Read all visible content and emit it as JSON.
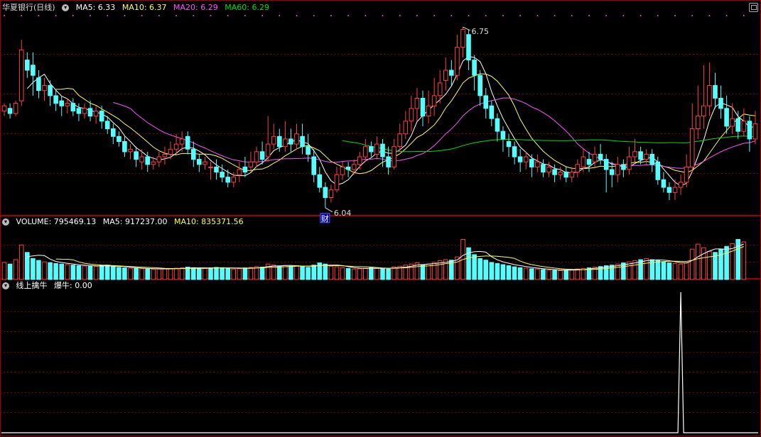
{
  "colors": {
    "up": "#ff4040",
    "down": "#54ffff",
    "ma5": "#ffffff",
    "ma10": "#ffff54",
    "ma20": "#ff54ff",
    "ma60": "#00e000",
    "grid": "#7a0000",
    "border": "#a00000",
    "signal": "#ffffff",
    "marker": "#ff40ff"
  },
  "header": {
    "stock_name": "华夏银行(日线)",
    "ma5": "MA5: 6.33",
    "ma10": "MA10: 6.37",
    "ma20": "MA20: 6.29",
    "ma60": "MA60: 6.29"
  },
  "volume_header": {
    "volume": "VOLUME: 795469.13",
    "ma5": "MA5: 917237.00",
    "ma10": "MA10: 835371.56"
  },
  "indicator_header": {
    "name": "线上擒牛",
    "value": "爆牛: 0.00"
  },
  "annotations": {
    "high_label": "6.75",
    "low_label": "6.04",
    "finance_tag": "财"
  },
  "chart_data": [
    {
      "type": "candlestick",
      "title": "华夏银行(日线)",
      "series_names": [
        "MA5",
        "MA10",
        "MA20",
        "MA60"
      ],
      "ylim": [
        6.02,
        6.8
      ],
      "candles": [
        [
          6.42,
          6.44,
          6.4,
          6.45
        ],
        [
          6.43,
          6.41,
          6.39,
          6.45
        ],
        [
          6.41,
          6.45,
          6.4,
          6.46
        ],
        [
          6.46,
          6.66,
          6.44,
          6.7
        ],
        [
          6.62,
          6.58,
          6.55,
          6.65
        ],
        [
          6.6,
          6.56,
          6.48,
          6.65
        ],
        [
          6.55,
          6.5,
          6.47,
          6.58
        ],
        [
          6.5,
          6.52,
          6.46,
          6.55
        ],
        [
          6.52,
          6.48,
          6.44,
          6.54
        ],
        [
          6.48,
          6.45,
          6.42,
          6.5
        ],
        [
          6.46,
          6.44,
          6.4,
          6.48
        ],
        [
          6.44,
          6.45,
          6.41,
          6.47
        ],
        [
          6.45,
          6.42,
          6.4,
          6.47
        ],
        [
          6.43,
          6.41,
          6.38,
          6.45
        ],
        [
          6.41,
          6.43,
          6.39,
          6.45
        ],
        [
          6.43,
          6.4,
          6.38,
          6.46
        ],
        [
          6.4,
          6.42,
          6.37,
          6.44
        ],
        [
          6.42,
          6.38,
          6.35,
          6.44
        ],
        [
          6.38,
          6.35,
          6.33,
          6.4
        ],
        [
          6.35,
          6.32,
          6.29,
          6.37
        ],
        [
          6.32,
          6.3,
          6.28,
          6.34
        ],
        [
          6.3,
          6.26,
          6.24,
          6.32
        ],
        [
          6.26,
          6.27,
          6.23,
          6.29
        ],
        [
          6.26,
          6.23,
          6.2,
          6.28
        ],
        [
          6.22,
          6.24,
          6.19,
          6.27
        ],
        [
          6.24,
          6.21,
          6.18,
          6.26
        ],
        [
          6.21,
          6.22,
          6.19,
          6.24
        ],
        [
          6.22,
          6.24,
          6.2,
          6.26
        ],
        [
          6.24,
          6.25,
          6.21,
          6.28
        ],
        [
          6.25,
          6.27,
          6.23,
          6.3
        ],
        [
          6.27,
          6.29,
          6.25,
          6.33
        ],
        [
          6.29,
          6.31,
          6.26,
          6.34
        ],
        [
          6.32,
          6.27,
          6.25,
          6.34
        ],
        [
          6.27,
          6.23,
          6.2,
          6.3
        ],
        [
          6.23,
          6.21,
          6.18,
          6.25
        ],
        [
          6.21,
          6.22,
          6.19,
          6.24
        ],
        [
          6.2,
          6.2,
          6.15,
          6.22
        ],
        [
          6.2,
          6.18,
          6.15,
          6.23
        ],
        [
          6.18,
          6.16,
          6.14,
          6.21
        ],
        [
          6.16,
          6.14,
          6.12,
          6.19
        ],
        [
          6.14,
          6.16,
          6.12,
          6.18
        ],
        [
          6.17,
          6.19,
          6.14,
          6.22
        ],
        [
          6.2,
          6.18,
          6.16,
          6.24
        ],
        [
          6.2,
          6.22,
          6.18,
          6.26
        ],
        [
          6.22,
          6.26,
          6.2,
          6.28
        ],
        [
          6.26,
          6.23,
          6.21,
          6.3
        ],
        [
          6.24,
          6.29,
          6.22,
          6.4
        ],
        [
          6.29,
          6.32,
          6.27,
          6.37
        ],
        [
          6.32,
          6.28,
          6.26,
          6.35
        ],
        [
          6.28,
          6.31,
          6.26,
          6.38
        ],
        [
          6.31,
          6.29,
          6.26,
          6.35
        ],
        [
          6.29,
          6.33,
          6.27,
          6.37
        ],
        [
          6.32,
          6.28,
          6.25,
          6.37
        ],
        [
          6.28,
          6.25,
          6.22,
          6.33
        ],
        [
          6.24,
          6.17,
          6.14,
          6.27
        ],
        [
          6.17,
          6.12,
          6.1,
          6.2
        ],
        [
          6.12,
          6.08,
          6.04,
          6.14
        ],
        [
          6.08,
          6.11,
          6.06,
          6.13
        ],
        [
          6.11,
          6.17,
          6.1,
          6.2
        ],
        [
          6.17,
          6.2,
          6.15,
          6.22
        ],
        [
          6.2,
          6.19,
          6.16,
          6.22
        ],
        [
          6.19,
          6.21,
          6.17,
          6.23
        ],
        [
          6.21,
          6.24,
          6.19,
          6.26
        ],
        [
          6.24,
          6.28,
          6.22,
          6.31
        ],
        [
          6.28,
          6.26,
          6.24,
          6.3
        ],
        [
          6.25,
          6.29,
          6.23,
          6.32
        ],
        [
          6.29,
          6.24,
          6.2,
          6.31
        ],
        [
          6.24,
          6.2,
          6.17,
          6.28
        ],
        [
          6.2,
          6.28,
          6.19,
          6.31
        ],
        [
          6.28,
          6.33,
          6.26,
          6.37
        ],
        [
          6.33,
          6.38,
          6.31,
          6.42
        ],
        [
          6.38,
          6.43,
          6.34,
          6.48
        ],
        [
          6.43,
          6.47,
          6.38,
          6.51
        ],
        [
          6.47,
          6.4,
          6.36,
          6.5
        ],
        [
          6.4,
          6.44,
          6.37,
          6.5
        ],
        [
          6.44,
          6.48,
          6.4,
          6.55
        ],
        [
          6.48,
          6.53,
          6.45,
          6.58
        ],
        [
          6.54,
          6.58,
          6.5,
          6.63
        ],
        [
          6.58,
          6.56,
          6.52,
          6.62
        ],
        [
          6.56,
          6.67,
          6.54,
          6.72
        ],
        [
          6.67,
          6.74,
          6.63,
          6.75
        ],
        [
          6.72,
          6.62,
          6.58,
          6.74
        ],
        [
          6.62,
          6.56,
          6.5,
          6.64
        ],
        [
          6.56,
          6.48,
          6.44,
          6.58
        ],
        [
          6.48,
          6.43,
          6.39,
          6.51
        ],
        [
          6.44,
          6.39,
          6.36,
          6.46
        ],
        [
          6.39,
          6.34,
          6.3,
          6.41
        ],
        [
          6.34,
          6.31,
          6.26,
          6.36
        ],
        [
          6.3,
          6.28,
          6.24,
          6.33
        ],
        [
          6.28,
          6.24,
          6.21,
          6.3
        ],
        [
          6.24,
          6.22,
          6.18,
          6.27
        ],
        [
          6.22,
          6.24,
          6.19,
          6.26
        ],
        [
          6.23,
          6.2,
          6.16,
          6.25
        ],
        [
          6.2,
          6.22,
          6.18,
          6.25
        ],
        [
          6.21,
          6.18,
          6.16,
          6.23
        ],
        [
          6.18,
          6.2,
          6.16,
          6.22
        ],
        [
          6.19,
          6.17,
          6.14,
          6.21
        ],
        [
          6.17,
          6.18,
          6.15,
          6.2
        ],
        [
          6.18,
          6.16,
          6.14,
          6.2
        ],
        [
          6.16,
          6.18,
          6.14,
          6.2
        ],
        [
          6.18,
          6.21,
          6.16,
          6.23
        ],
        [
          6.2,
          6.24,
          6.18,
          6.27
        ],
        [
          6.23,
          6.21,
          6.18,
          6.26
        ],
        [
          6.22,
          6.25,
          6.2,
          6.28
        ],
        [
          6.25,
          6.23,
          6.21,
          6.29
        ],
        [
          6.23,
          6.19,
          6.1,
          6.25
        ],
        [
          6.19,
          6.17,
          6.12,
          6.22
        ],
        [
          6.17,
          6.21,
          6.14,
          6.24
        ],
        [
          6.21,
          6.19,
          6.16,
          6.23
        ],
        [
          6.19,
          6.24,
          6.17,
          6.28
        ],
        [
          6.24,
          6.26,
          6.22,
          6.31
        ],
        [
          6.26,
          6.23,
          6.21,
          6.28
        ],
        [
          6.23,
          6.25,
          6.21,
          6.27
        ],
        [
          6.25,
          6.21,
          6.18,
          6.27
        ],
        [
          6.22,
          6.15,
          6.13,
          6.24
        ],
        [
          6.15,
          6.12,
          6.1,
          6.18
        ],
        [
          6.12,
          6.1,
          6.07,
          6.14
        ],
        [
          6.1,
          6.12,
          6.07,
          6.15
        ],
        [
          6.12,
          6.14,
          6.09,
          6.17
        ],
        [
          6.14,
          6.2,
          6.12,
          6.25
        ],
        [
          6.2,
          6.35,
          6.18,
          6.45
        ],
        [
          6.35,
          6.4,
          6.31,
          6.52
        ],
        [
          6.4,
          6.44,
          6.35,
          6.6
        ],
        [
          6.44,
          6.52,
          6.4,
          6.61
        ],
        [
          6.52,
          6.47,
          6.43,
          6.57
        ],
        [
          6.47,
          6.43,
          6.39,
          6.52
        ],
        [
          6.43,
          6.36,
          6.33,
          6.48
        ],
        [
          6.36,
          6.39,
          6.33,
          6.45
        ],
        [
          6.39,
          6.34,
          6.31,
          6.42
        ],
        [
          6.34,
          6.38,
          6.32,
          6.43
        ],
        [
          6.38,
          6.31,
          6.26,
          6.4
        ],
        [
          6.31,
          6.37,
          6.29,
          6.42
        ]
      ],
      "annotations": [
        {
          "label": "6.75",
          "role": "period-high"
        },
        {
          "label": "6.04",
          "role": "period-low"
        },
        {
          "label": "财",
          "role": "financial-report-marker"
        }
      ]
    },
    {
      "type": "bar",
      "title": "VOLUME",
      "series_names": [
        "VOLUME",
        "MA5",
        "MA10"
      ],
      "ylim": [
        0,
        1900000
      ],
      "values": [
        620000,
        560000,
        720000,
        1250000,
        980000,
        760000,
        690000,
        640000,
        610000,
        580000,
        560000,
        540000,
        520000,
        500000,
        490000,
        480000,
        470000,
        500000,
        520000,
        460000,
        440000,
        420000,
        410000,
        400000,
        390000,
        380000,
        370000,
        380000,
        390000,
        400000,
        410000,
        420000,
        450000,
        430000,
        410000,
        400000,
        420000,
        440000,
        430000,
        400000,
        380000,
        390000,
        420000,
        440000,
        470000,
        450000,
        560000,
        520000,
        480000,
        510000,
        480000,
        500000,
        470000,
        440000,
        520000,
        600000,
        560000,
        480000,
        460000,
        420000,
        400000,
        380000,
        390000,
        410000,
        430000,
        420000,
        400000,
        380000,
        460000,
        480000,
        520000,
        560000,
        600000,
        540000,
        560000,
        620000,
        680000,
        720000,
        700000,
        820000,
        1450000,
        1150000,
        900000,
        760000,
        700000,
        620000,
        580000,
        540000,
        500000,
        460000,
        430000,
        410000,
        390000,
        380000,
        360000,
        340000,
        330000,
        320000,
        340000,
        360000,
        380000,
        400000,
        420000,
        450000,
        470000,
        500000,
        520000,
        560000,
        600000,
        640000,
        680000,
        720000,
        760000,
        720000,
        680000,
        640000,
        600000,
        580000,
        560000,
        600000,
        1100000,
        1280000,
        1150000,
        1020000,
        980000,
        1100000,
        1200000,
        1300000,
        1450000,
        1360000
      ],
      "up_flags": [
        true,
        false,
        true,
        true,
        false,
        false,
        false,
        true,
        false,
        false,
        false,
        true,
        false,
        false,
        true,
        false,
        true,
        false,
        false,
        false,
        false,
        false,
        true,
        false,
        true,
        false,
        true,
        true,
        true,
        true,
        true,
        true,
        false,
        false,
        false,
        true,
        false,
        false,
        false,
        false,
        true,
        true,
        false,
        true,
        true,
        false,
        true,
        true,
        false,
        true,
        false,
        true,
        false,
        false,
        false,
        false,
        false,
        true,
        true,
        true,
        false,
        true,
        true,
        true,
        false,
        true,
        false,
        false,
        true,
        true,
        true,
        true,
        true,
        false,
        true,
        true,
        true,
        true,
        false,
        true,
        true,
        false,
        false,
        false,
        false,
        false,
        false,
        false,
        false,
        false,
        false,
        true,
        false,
        true,
        false,
        true,
        false,
        true,
        false,
        true,
        true,
        true,
        false,
        true,
        false,
        false,
        false,
        true,
        false,
        true,
        true,
        false,
        true,
        false,
        false,
        false,
        false,
        true,
        true,
        true,
        true,
        true,
        true,
        true,
        false,
        false,
        false,
        true,
        false,
        true
      ]
    },
    {
      "type": "line",
      "title": "线上擒牛",
      "series_names": [
        "爆牛"
      ],
      "ylim": [
        0,
        1
      ],
      "signal_index": 118,
      "values": [
        0
      ]
    }
  ]
}
